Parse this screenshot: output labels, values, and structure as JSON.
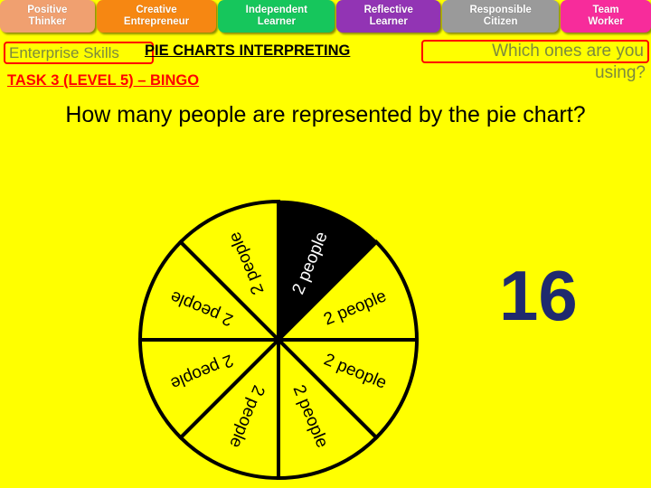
{
  "skill_bar": {
    "tabs": [
      {
        "line1": "Positive",
        "line2": "Thinker",
        "color": "#f0a070"
      },
      {
        "line1": "Creative",
        "line2": "Entrepreneur",
        "color": "#f68712"
      },
      {
        "line1": "Independent",
        "line2": "Learner",
        "color": "#16c65c"
      },
      {
        "line1": "Reflective",
        "line2": "Learner",
        "color": "#9234b4"
      },
      {
        "line1": "Responsible",
        "line2": "Citizen",
        "color": "#9a9a9a"
      },
      {
        "line1": "Team",
        "line2": "Worker",
        "color": "#f72c9b"
      }
    ]
  },
  "header": {
    "enterprise_skills": "Enterprise Skills",
    "topic_title": "PIE CHARTS INTERPRETING",
    "task_title": "TASK 3 (LEVEL 5) – BINGO",
    "prompt_line1": "Which ones are you",
    "prompt_line2": "using?"
  },
  "question": "How many people are represented by the pie chart?",
  "answer": "16",
  "colors": {
    "page_background": "#ffff00",
    "answer_text": "#1f2a6e",
    "task_title": "#ff0000",
    "enterprise_text": "#7c8a3d",
    "highlight_box_border": "#ff0000",
    "pie_fill": "#ffff00",
    "pie_highlight_fill": "#000000",
    "pie_stroke": "#000000"
  },
  "chart_data": {
    "type": "pie",
    "title": "",
    "labels": [
      "2 people",
      "2 people",
      "2 people",
      "2 people",
      "2 people",
      "2 people",
      "2 people",
      "2 people"
    ],
    "values": [
      2,
      2,
      2,
      2,
      2,
      2,
      2,
      2
    ],
    "unit": "people",
    "slice_count": 8,
    "total": 16,
    "highlighted_index": 0,
    "highlight_fill": "#000000",
    "slice_fill": "#ffff00",
    "stroke": "#000000",
    "start_angle_deg": 0,
    "legend": "none",
    "grid": false
  }
}
